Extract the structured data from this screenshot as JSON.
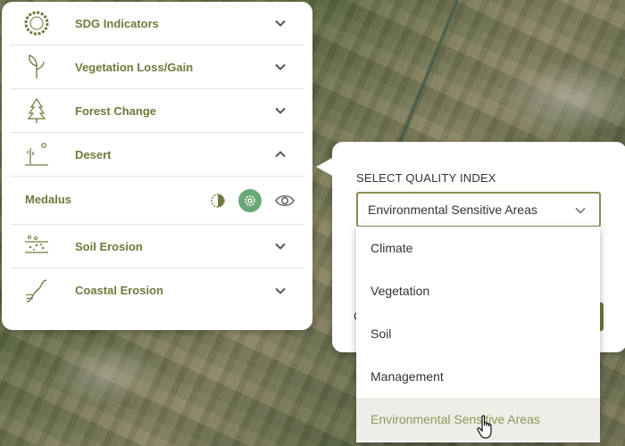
{
  "panel": {
    "rows": [
      {
        "label": "SDG Indicators",
        "icon": "sdg-wheel-icon",
        "expanded": false
      },
      {
        "label": "Vegetation Loss/Gain",
        "icon": "sprout-icon",
        "expanded": false
      },
      {
        "label": "Forest Change",
        "icon": "tree-icon",
        "expanded": false
      },
      {
        "label": "Desert",
        "icon": "desert-icon",
        "expanded": true
      },
      {
        "label": "Soil Erosion",
        "icon": "soil-icon",
        "expanded": false
      },
      {
        "label": "Coastal Erosion",
        "icon": "coast-icon",
        "expanded": false
      }
    ],
    "sublayer": {
      "label": "Medalus",
      "controls": [
        "opacity-icon",
        "settings-icon",
        "visibility-icon"
      ]
    }
  },
  "popover": {
    "title": "SELECT QUALITY INDEX",
    "selected": "Environmental Sensitive Areas",
    "hidden_row_text": "C"
  },
  "dropdown": {
    "options": [
      "Climate",
      "Vegetation",
      "Soil",
      "Management",
      "Environmental Sensitive Areas"
    ],
    "highlighted_index": 4
  },
  "colors": {
    "accent": "#6f7a3c",
    "settings_active": "#6aa877",
    "highlight_bg": "#eceee7"
  }
}
